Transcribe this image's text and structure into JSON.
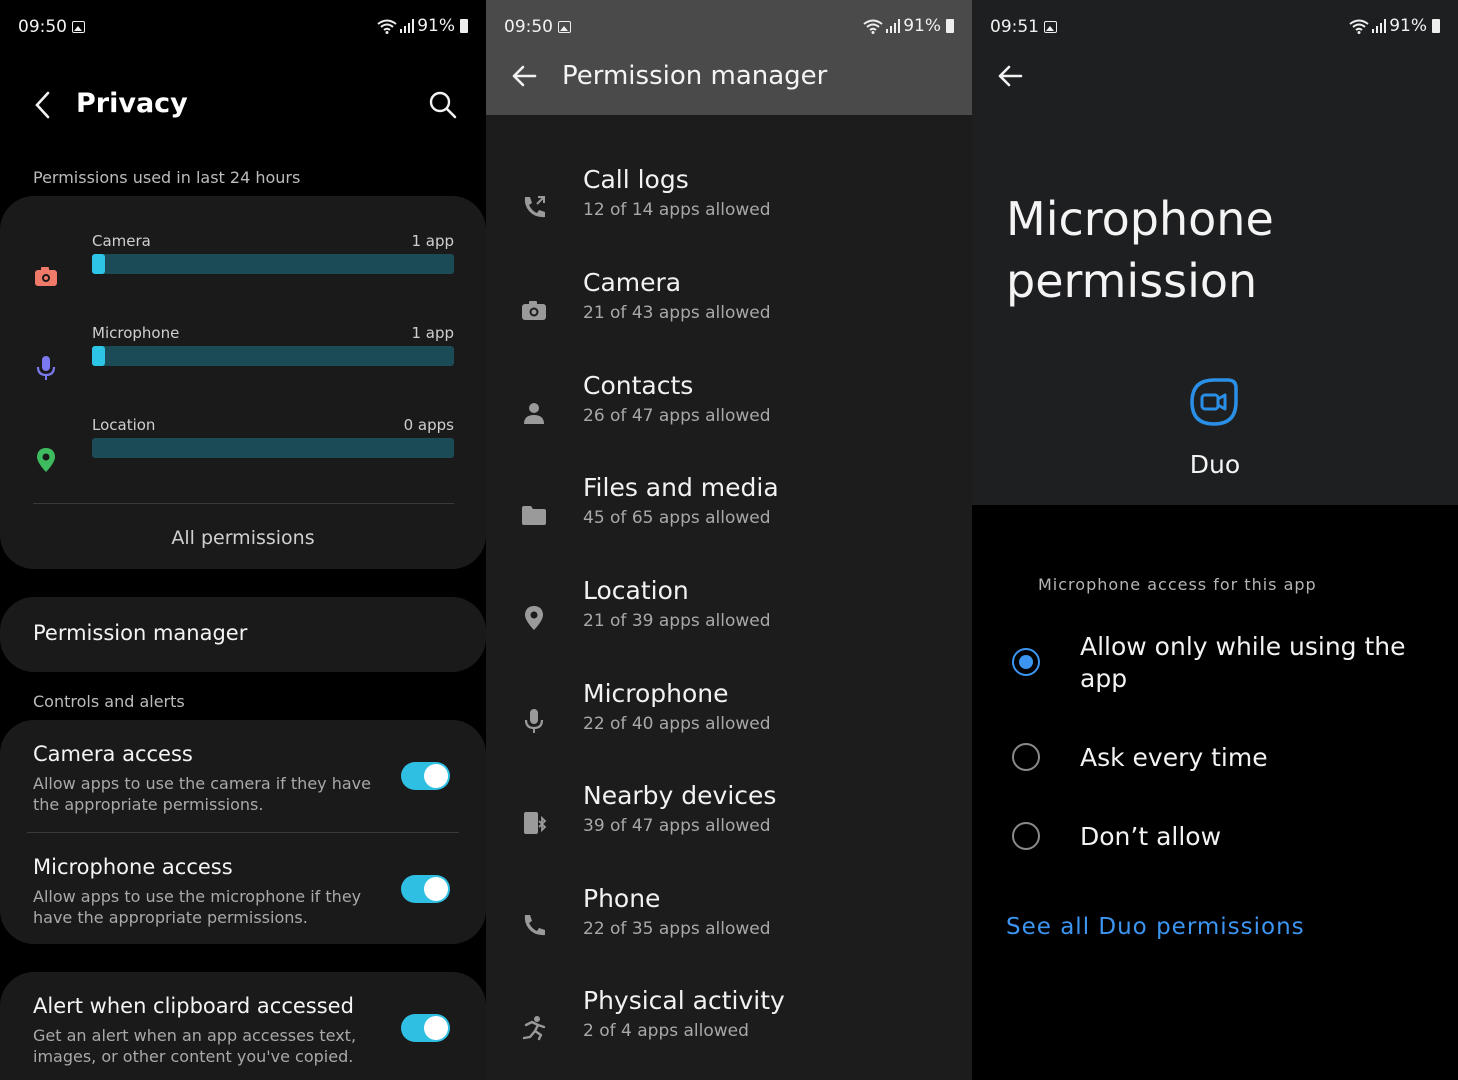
{
  "panel1": {
    "status": {
      "time": "09:50",
      "battery": "91%"
    },
    "title": "Privacy",
    "section_recent": "Permissions used in last 24 hours",
    "usage": [
      {
        "label": "Camera",
        "count": "1 app",
        "fraction": 0.035
      },
      {
        "label": "Microphone",
        "count": "1 app",
        "fraction": 0.035
      },
      {
        "label": "Location",
        "count": "0 apps",
        "fraction": 0
      }
    ],
    "all_permissions": "All permissions",
    "permission_manager": "Permission manager",
    "section_controls": "Controls and alerts",
    "toggles": [
      {
        "title": "Camera access",
        "desc": "Allow apps to use the camera if they have the appropriate permissions.",
        "on": true
      },
      {
        "title": "Microphone access",
        "desc": "Allow apps to use the microphone if they have the appropriate permissions.",
        "on": true
      },
      {
        "title": "Alert when clipboard accessed",
        "desc": "Get an alert when an app accesses text, images, or other content you've copied.",
        "on": true
      }
    ],
    "colors": {
      "accent": "#2ec4e6",
      "bar_track": "#1b4b57",
      "camera_icon": "#f07a6a",
      "mic_icon": "#7b79ee",
      "location_icon": "#3dbb5e"
    }
  },
  "panel2": {
    "status": {
      "time": "09:50",
      "battery": "91%"
    },
    "title": "Permission manager",
    "items": [
      {
        "name": "Call logs",
        "sub": "12 of 14 apps allowed",
        "icon": "call-log-icon"
      },
      {
        "name": "Camera",
        "sub": "21 of 43 apps allowed",
        "icon": "camera-icon"
      },
      {
        "name": "Contacts",
        "sub": "26 of 47 apps allowed",
        "icon": "person-icon"
      },
      {
        "name": "Files and media",
        "sub": "45 of 65 apps allowed",
        "icon": "folder-icon"
      },
      {
        "name": "Location",
        "sub": "21 of 39 apps allowed",
        "icon": "location-pin-icon"
      },
      {
        "name": "Microphone",
        "sub": "22 of 40 apps allowed",
        "icon": "microphone-icon"
      },
      {
        "name": "Nearby devices",
        "sub": "39 of 47 apps allowed",
        "icon": "nearby-devices-icon"
      },
      {
        "name": "Phone",
        "sub": "22 of 35 apps allowed",
        "icon": "phone-icon"
      },
      {
        "name": "Physical activity",
        "sub": "2 of 4 apps allowed",
        "icon": "running-icon"
      }
    ]
  },
  "panel3": {
    "status": {
      "time": "09:51",
      "battery": "91%"
    },
    "title": "Microphone permission",
    "app_name": "Duo",
    "access_label": "Microphone access for this app",
    "options": [
      {
        "label": "Allow only while using the app",
        "selected": true
      },
      {
        "label": "Ask every time",
        "selected": false
      },
      {
        "label": "Don’t allow",
        "selected": false
      }
    ],
    "see_all": "See all Duo permissions",
    "colors": {
      "accent": "#3d95f2"
    }
  }
}
